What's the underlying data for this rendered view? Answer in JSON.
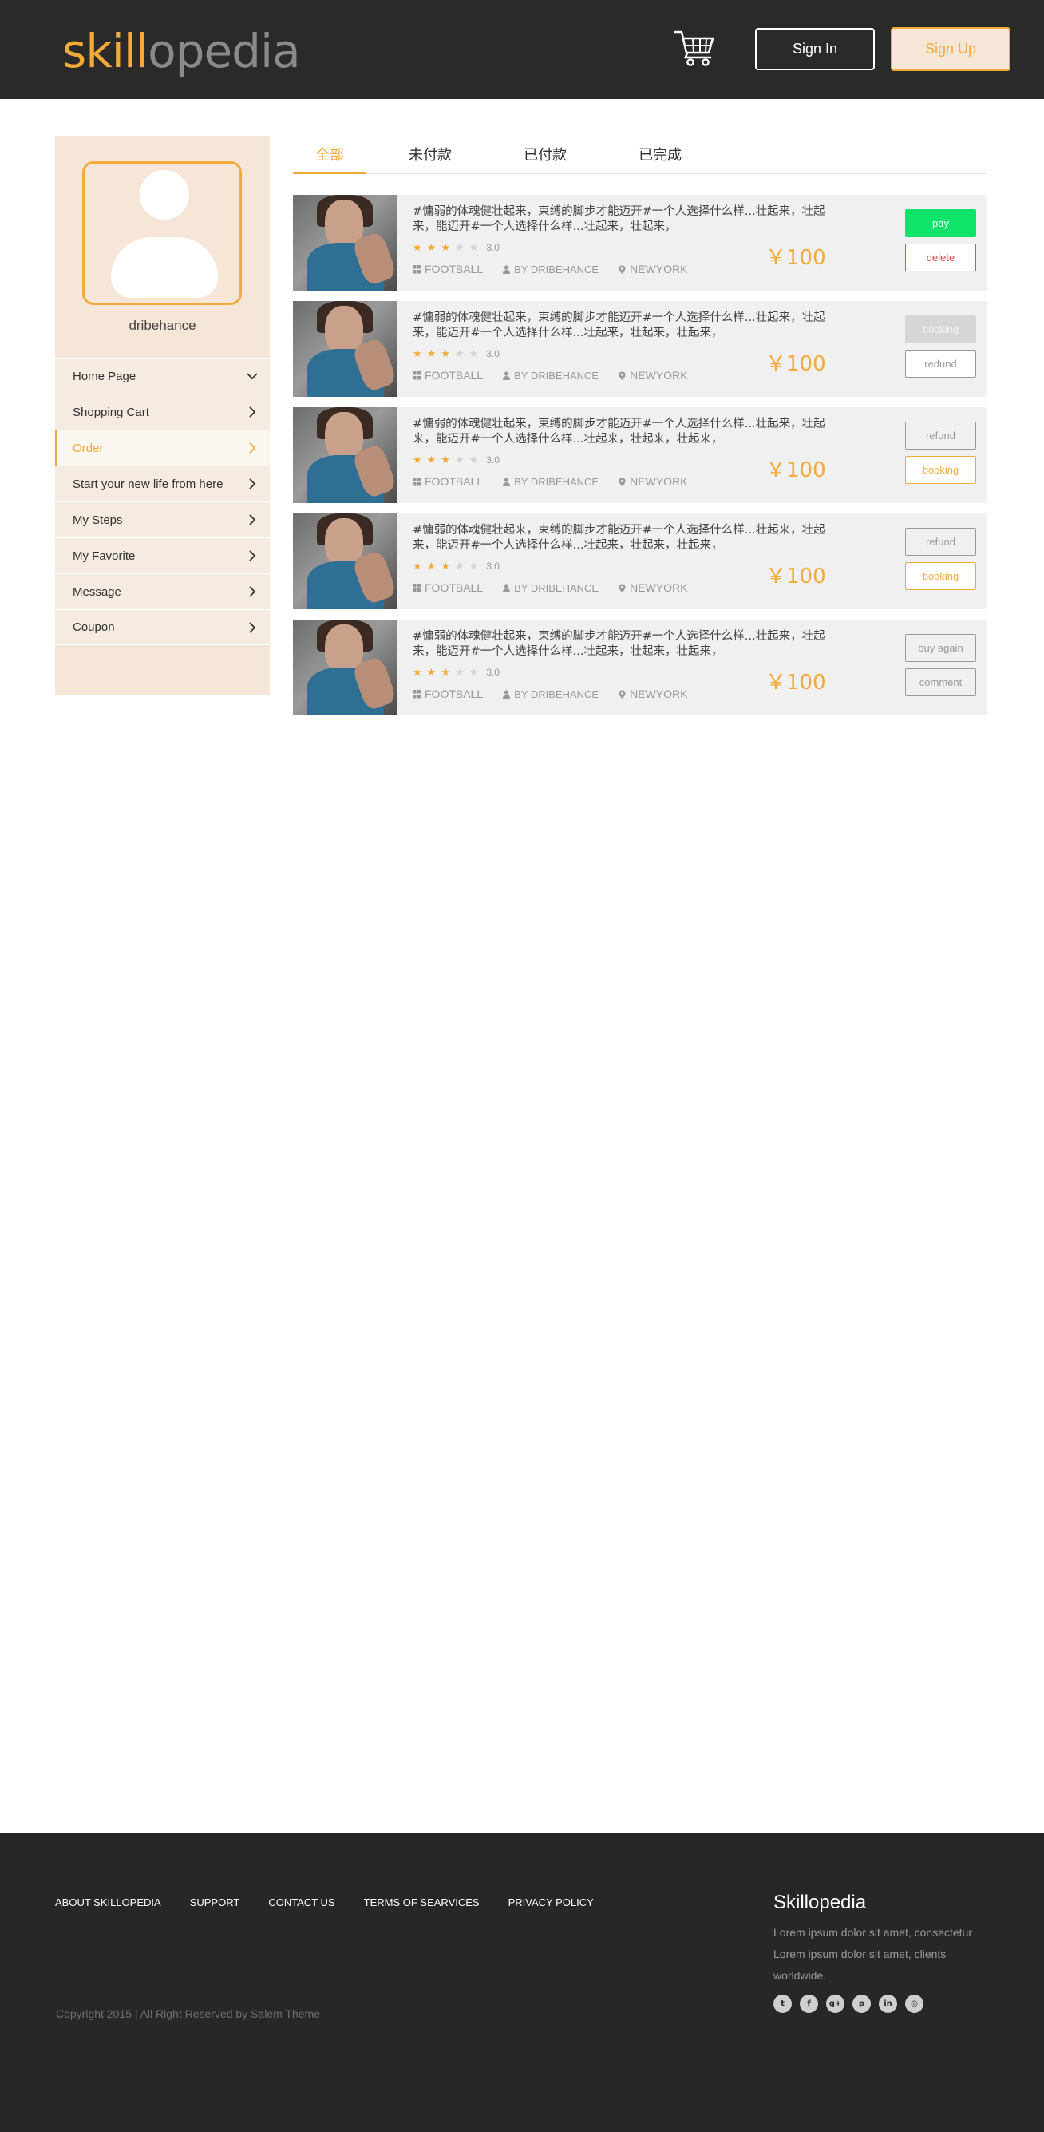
{
  "header": {
    "logo_part1": "skill",
    "logo_part2": "opedia",
    "cart_icon": "shopping-cart-icon",
    "sign_in_label": "Sign In",
    "sign_up_label": "Sign Up"
  },
  "colors": {
    "accent": "#f2ab39",
    "header_bg": "#2a2a2a",
    "sidebar_bg": "#f5e6d8",
    "card_bg": "#f0f0f0",
    "pay_green": "#10e36a",
    "delete_red": "#e04a4a",
    "footer_bg": "#272727"
  },
  "sidebar": {
    "avatar_icon": "user-avatar-icon",
    "username": "dribehance",
    "items": [
      {
        "label": "Home Page",
        "chevron": "chevron-down-icon"
      },
      {
        "label": "Shopping Cart",
        "chevron": "chevron-right-icon"
      },
      {
        "label": "Order",
        "chevron": "chevron-right-icon",
        "active": true
      },
      {
        "label": "Start your new life from here",
        "chevron": "chevron-right-icon"
      },
      {
        "label": "My Steps",
        "chevron": "chevron-right-icon"
      },
      {
        "label": "My Favorite",
        "chevron": "chevron-right-icon"
      },
      {
        "label": "Message",
        "chevron": "chevron-right-icon"
      },
      {
        "label": "Coupon",
        "chevron": "chevron-right-icon"
      }
    ]
  },
  "tabs": [
    {
      "label": "全部",
      "active": true
    },
    {
      "label": "未付款"
    },
    {
      "label": "已付款"
    },
    {
      "label": "已完成"
    }
  ],
  "orders": [
    {
      "title": "#慵弱的体魂健壮起来，束缚的脚步才能迈开#一个人选择什么样...壮起来，壮起来，能迈开#一个人选择什么样...壮起来，壮起来，",
      "stars": 3,
      "rating": "3.0",
      "category": "FOOTBALL",
      "author": "BY DRIBEHANCE",
      "location": "NEWYORK",
      "price": "￥100",
      "btn1": "pay",
      "btn2": "delete"
    },
    {
      "title": "#慵弱的体魂健壮起来，束缚的脚步才能迈开#一个人选择什么样...壮起来，壮起来，能迈开#一个人选择什么样...壮起来，壮起来，壮起来，",
      "stars": 3,
      "rating": "3.0",
      "category": "FOOTBALL",
      "author": "BY DRIBEHANCE",
      "location": "NEWYORK",
      "price": "￥100",
      "btn1": "booking",
      "btn2": "redund"
    },
    {
      "title": "#慵弱的体魂健壮起来，束缚的脚步才能迈开#一个人选择什么样...壮起来，壮起来，能迈开#一个人选择什么样...壮起来，壮起来，壮起来，",
      "stars": 3,
      "rating": "3.0",
      "category": "FOOTBALL",
      "author": "BY DRIBEHANCE",
      "location": "NEWYORK",
      "price": "￥100",
      "btn1": "refund",
      "btn2": "booking"
    },
    {
      "title": "#慵弱的体魂健壮起来，束缚的脚步才能迈开#一个人选择什么样...壮起来，壮起来，能迈开#一个人选择什么样...壮起来，壮起来，壮起来，",
      "stars": 3,
      "rating": "3.0",
      "category": "FOOTBALL",
      "author": "BY DRIBEHANCE",
      "location": "NEWYORK",
      "price": "￥100",
      "btn1": "refund",
      "btn2": "booking"
    },
    {
      "title": "#慵弱的体魂健壮起来，束缚的脚步才能迈开#一个人选择什么样...壮起来，壮起来，能迈开#一个人选择什么样...壮起来，壮起来，壮起来，",
      "stars": 3,
      "rating": "3.0",
      "category": "FOOTBALL",
      "author": "BY DRIBEHANCE",
      "location": "NEWYORK",
      "price": "￥100",
      "btn1": "buy again",
      "btn2": "comment"
    }
  ],
  "footer": {
    "links": [
      "ABOUT SKILLOPEDIA",
      "SUPPORT",
      "CONTACT US",
      "TERMS OF SEARVICES",
      "PRIVACY POLICY"
    ],
    "copyright": "Copyright 2015 | All Right Reserved by Salem Theme",
    "brand": "Skillopedia",
    "description": "Lorem ipsum dolor sit amet, consectetur Lorem ipsum dolor sit amet,  clients worldwide.",
    "socials": [
      {
        "icon": "twitter-icon",
        "glyph": "t"
      },
      {
        "icon": "facebook-icon",
        "glyph": "f"
      },
      {
        "icon": "google-plus-icon",
        "glyph": "g+"
      },
      {
        "icon": "pinterest-icon",
        "glyph": "p"
      },
      {
        "icon": "linkedin-icon",
        "glyph": "in"
      },
      {
        "icon": "dribbble-icon",
        "glyph": "◎"
      }
    ]
  }
}
